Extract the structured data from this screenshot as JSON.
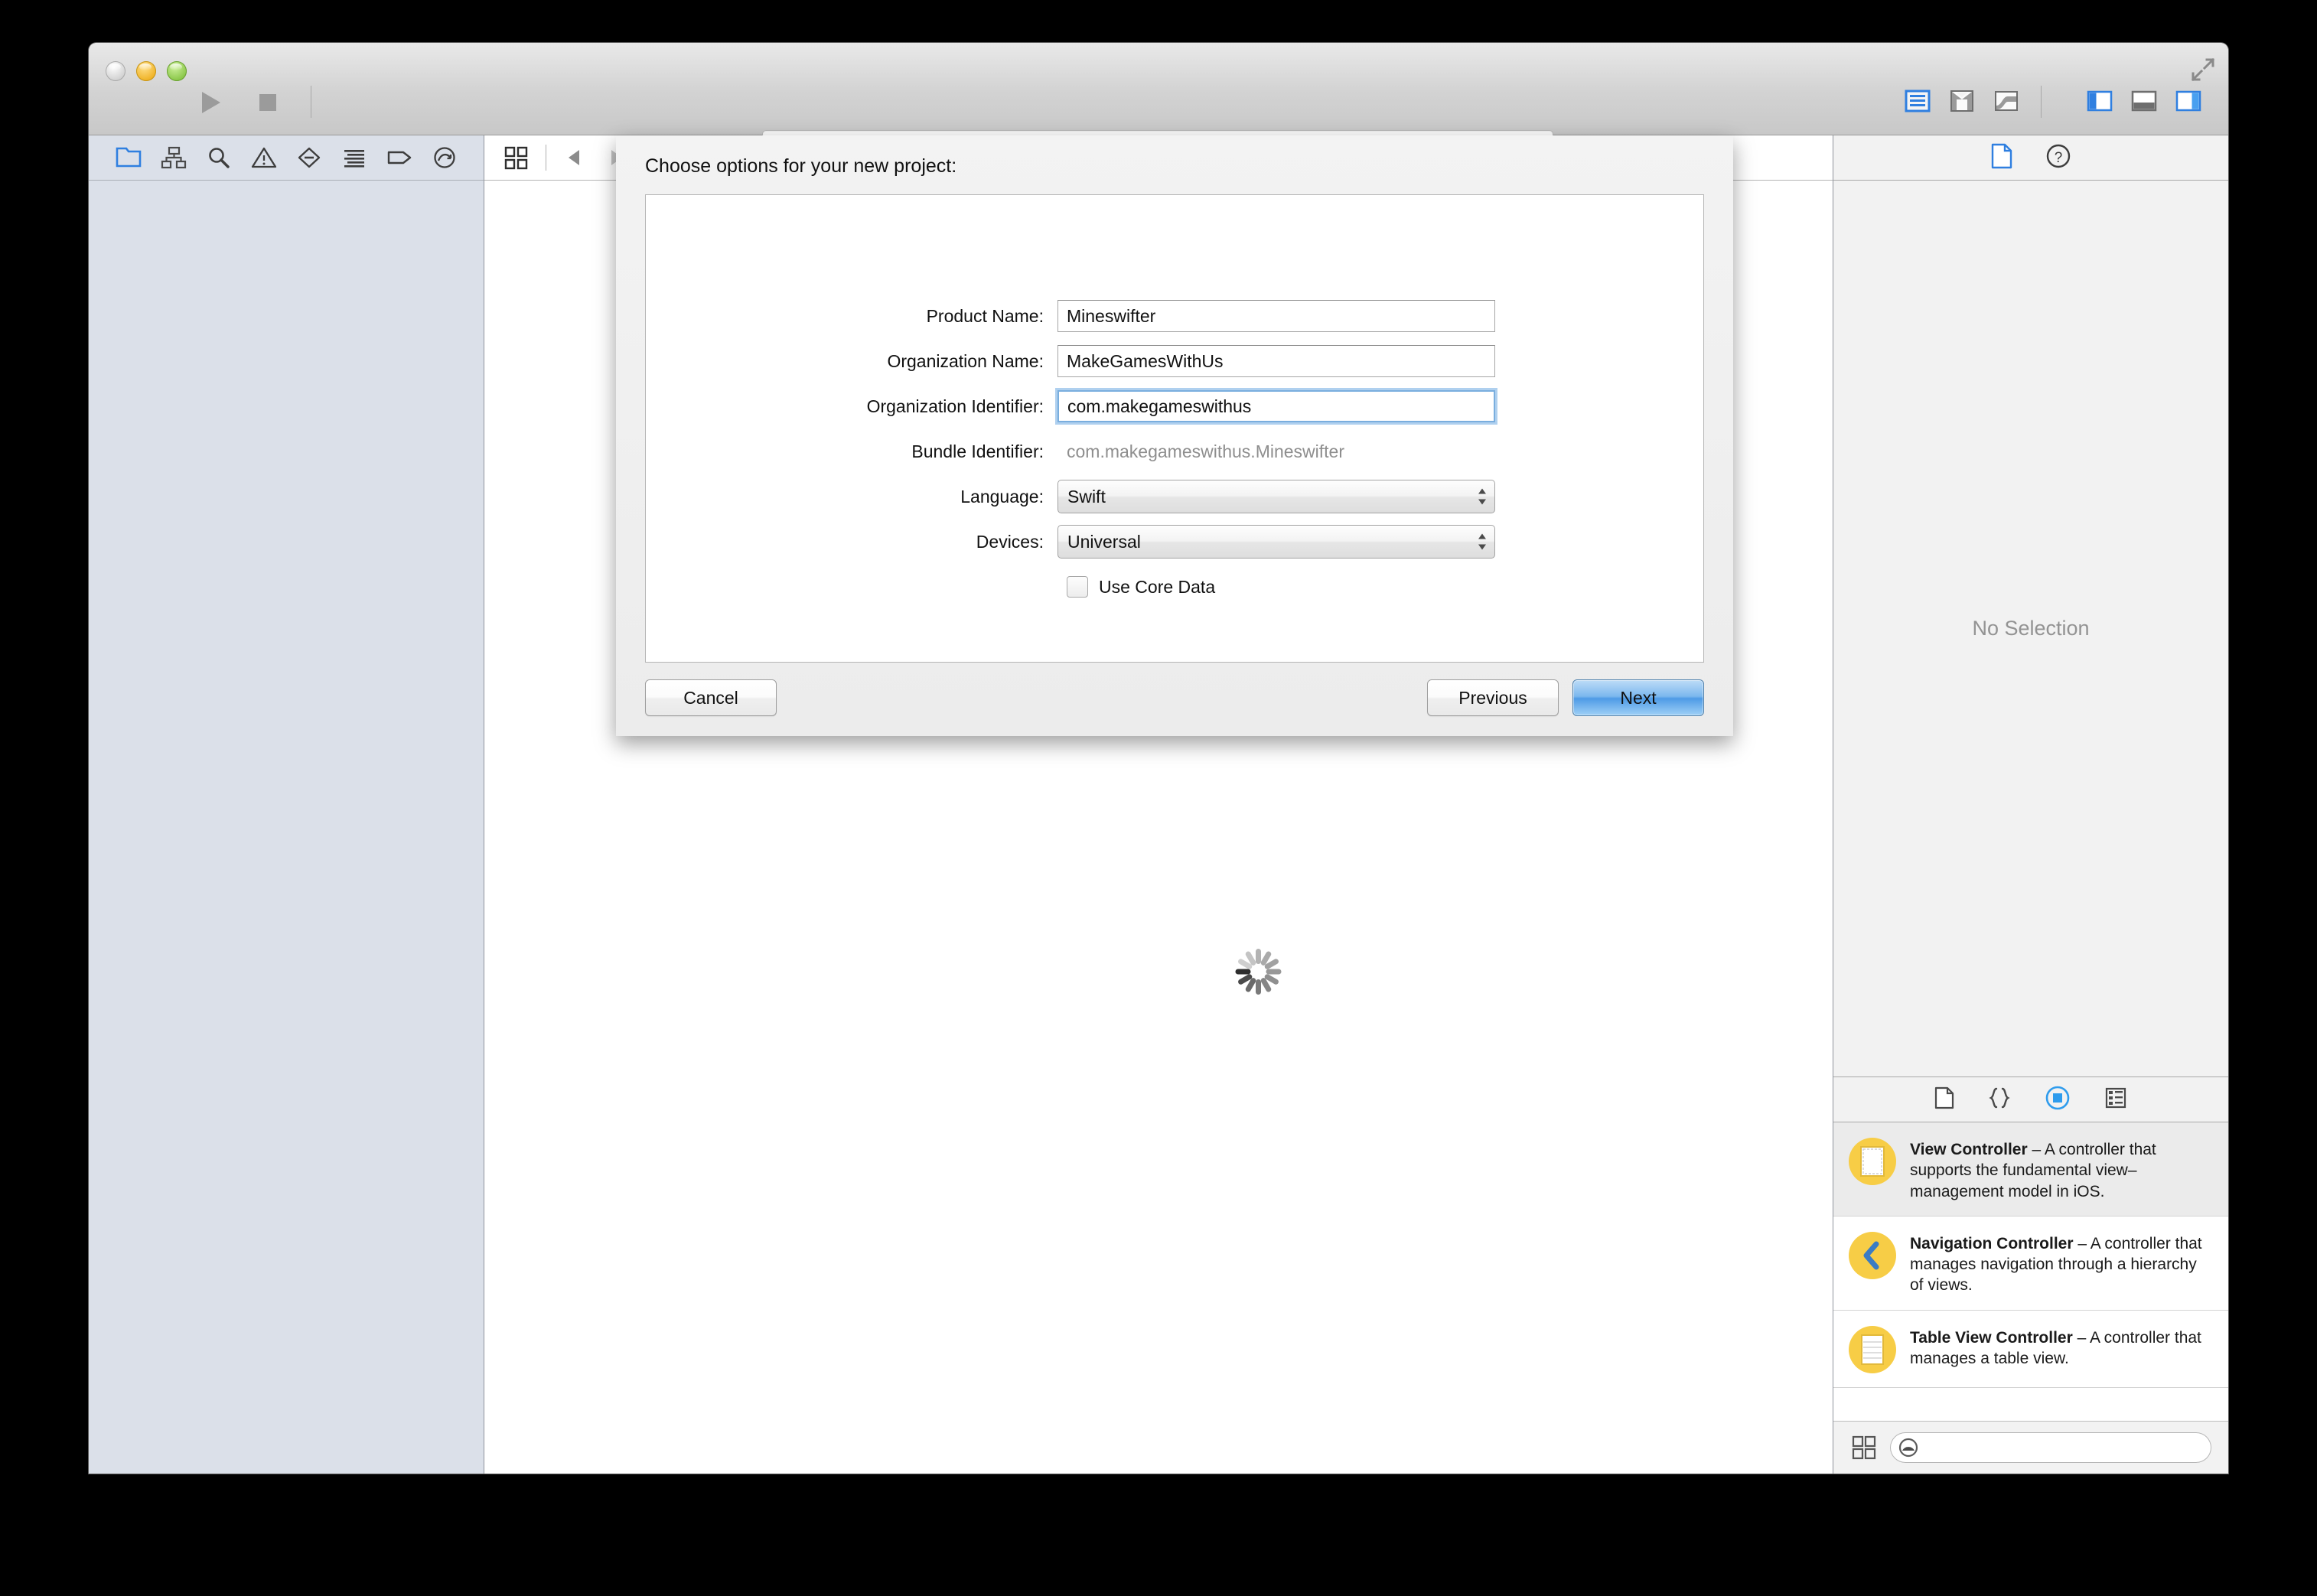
{
  "window": {
    "traffic_lights": [
      "close",
      "minimize",
      "zoom"
    ],
    "fullscreen_label": "fullscreen"
  },
  "toolbar": {
    "run_label": "Run",
    "stop_label": "Stop",
    "status": {
      "text": "Loading",
      "icon": "spinner-icon"
    },
    "editor_modes": [
      {
        "name": "standard-editor",
        "selected": true
      },
      {
        "name": "assistant-editor",
        "selected": false
      },
      {
        "name": "version-editor",
        "selected": false
      }
    ],
    "view_toggles": [
      {
        "name": "toggle-navigator",
        "selected": true
      },
      {
        "name": "toggle-debug-area",
        "selected": false
      },
      {
        "name": "toggle-utilities",
        "selected": true
      }
    ]
  },
  "navigator": {
    "tabs": [
      {
        "name": "project-navigator",
        "selected": true
      },
      {
        "name": "symbol-navigator",
        "selected": false
      },
      {
        "name": "find-navigator",
        "selected": false
      },
      {
        "name": "issue-navigator",
        "selected": false
      },
      {
        "name": "test-navigator",
        "selected": false
      },
      {
        "name": "debug-navigator",
        "selected": false
      },
      {
        "name": "breakpoint-navigator",
        "selected": false
      },
      {
        "name": "report-navigator",
        "selected": false
      }
    ]
  },
  "editor": {
    "jump_bar": {
      "related_items": "related-items-icon",
      "back": "back-arrow",
      "forward": "forward-arrow"
    }
  },
  "inspector": {
    "tabs": [
      {
        "name": "file-inspector",
        "selected": true
      },
      {
        "name": "quick-help-inspector",
        "selected": false
      }
    ],
    "empty_state": "No Selection"
  },
  "library": {
    "tabs": [
      {
        "name": "file-template-library",
        "selected": false
      },
      {
        "name": "code-snippet-library",
        "selected": false
      },
      {
        "name": "object-library",
        "selected": true
      },
      {
        "name": "media-library",
        "selected": false
      }
    ],
    "items": [
      {
        "title": "View Controller",
        "description": "– A controller that supports the fundamental view–management model in iOS.",
        "selected": true,
        "icon": "view-controller-icon"
      },
      {
        "title": "Navigation Controller",
        "description": "– A controller that manages navigation through a hierarchy of views.",
        "selected": false,
        "icon": "navigation-controller-icon"
      },
      {
        "title": "Table View Controller",
        "description": "– A controller that manages a table view.",
        "selected": false,
        "icon": "table-view-controller-icon"
      }
    ],
    "filter_placeholder": ""
  },
  "sheet": {
    "title": "Choose options for your new project:",
    "fields": [
      {
        "label": "Product Name:",
        "value": "Mineswifter",
        "type": "text",
        "focused": false
      },
      {
        "label": "Organization Name:",
        "value": "MakeGamesWithUs",
        "type": "text",
        "focused": false
      },
      {
        "label": "Organization Identifier:",
        "value": "com.makegameswithus",
        "type": "text",
        "focused": true
      },
      {
        "label": "Bundle Identifier:",
        "value": "com.makegameswithus.Mineswifter",
        "type": "static",
        "focused": false
      },
      {
        "label": "Language:",
        "value": "Swift",
        "type": "select",
        "focused": false
      },
      {
        "label": "Devices:",
        "value": "Universal",
        "type": "select",
        "focused": false
      }
    ],
    "checkbox": {
      "label": "Use Core Data",
      "checked": false
    },
    "buttons": {
      "cancel": "Cancel",
      "previous": "Previous",
      "next": "Next"
    }
  },
  "colors": {
    "accent_blue": "#2f7fe0",
    "library_yellow": "#f7cd46",
    "default_button_blue": "#4e9be6",
    "focus_ring": "#7aaede"
  }
}
